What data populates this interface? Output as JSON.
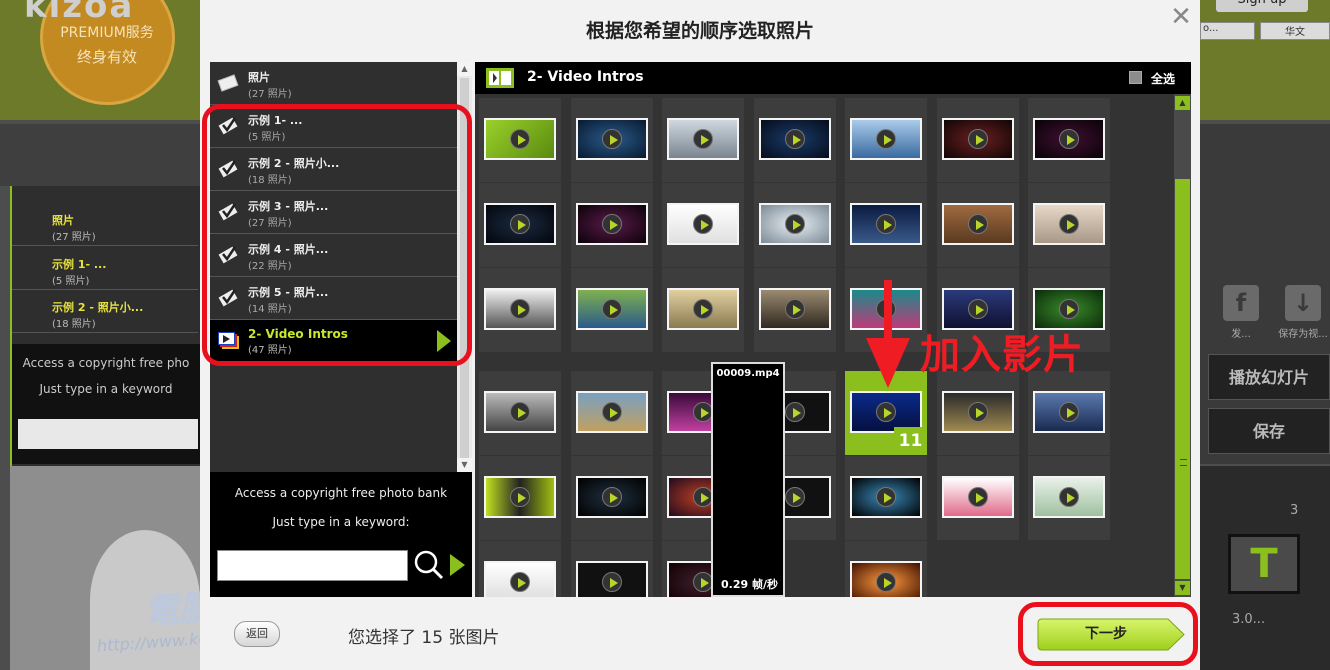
{
  "background": {
    "logo": "kizoa",
    "premium": "PREMIUM服务",
    "lifetime": "终身有效",
    "signup": "Sign up",
    "font_select": "o...",
    "font_family": "华文",
    "left_items": [
      {
        "name": "照片",
        "count": "(27 照片)"
      },
      {
        "name": "示例 1- ...",
        "count": "(5 照片)"
      },
      {
        "name": "示例 2 - 照片小...",
        "count": "(18 照片)"
      }
    ],
    "access_text": "Access a copyright free pho",
    "keyword_text": "Just type in a keyword",
    "share_fb": "发...",
    "share_save": "保存为视...",
    "play_slideshow": "播放幻灯片",
    "save": "保存",
    "timeline_num": "3",
    "timeline_time": "3.0...",
    "watermark_site": "http://www.kocpc.com.tw"
  },
  "dialog": {
    "title": "根据您希望的顺序选取照片",
    "close_icon": "close-icon",
    "albums": [
      {
        "name": "照片",
        "count": "(27 照片)",
        "icon": "photo-stack-icon"
      },
      {
        "name": "示例 1- ...",
        "count": "(5 照片)",
        "icon": "example-check-icon"
      },
      {
        "name": "示例 2 - 照片小...",
        "count": "(18 照片)",
        "icon": "example-check-icon"
      },
      {
        "name": "示例 3 - 照片...",
        "count": "(27 照片)",
        "icon": "example-check-icon"
      },
      {
        "name": "示例 4 - 照片...",
        "count": "(22 照片)",
        "icon": "example-check-icon"
      },
      {
        "name": "示例 5 - 照片...",
        "count": "(14 照片)",
        "icon": "example-check-icon"
      },
      {
        "name": "2- Video Intros",
        "count": "(47 照片)",
        "icon": "video-album-icon",
        "selected": true
      }
    ],
    "access": {
      "line1": "Access a copyright free photo bank",
      "line2": "Just type in a keyword:",
      "keyword_value": ""
    },
    "grid_header": {
      "title": "2- Video Intros",
      "select_all": "全选"
    },
    "tooltip": {
      "filename": "00009.mp4",
      "fps": "0.29 帧/秒"
    },
    "selected_badge": "11",
    "annotation": "加入影片",
    "back": "返回",
    "status": "您选择了 15 张图片",
    "next": "下一步"
  },
  "colors": {
    "accent_green": "#8bbf1d",
    "annotation_red": "#f01c24"
  }
}
